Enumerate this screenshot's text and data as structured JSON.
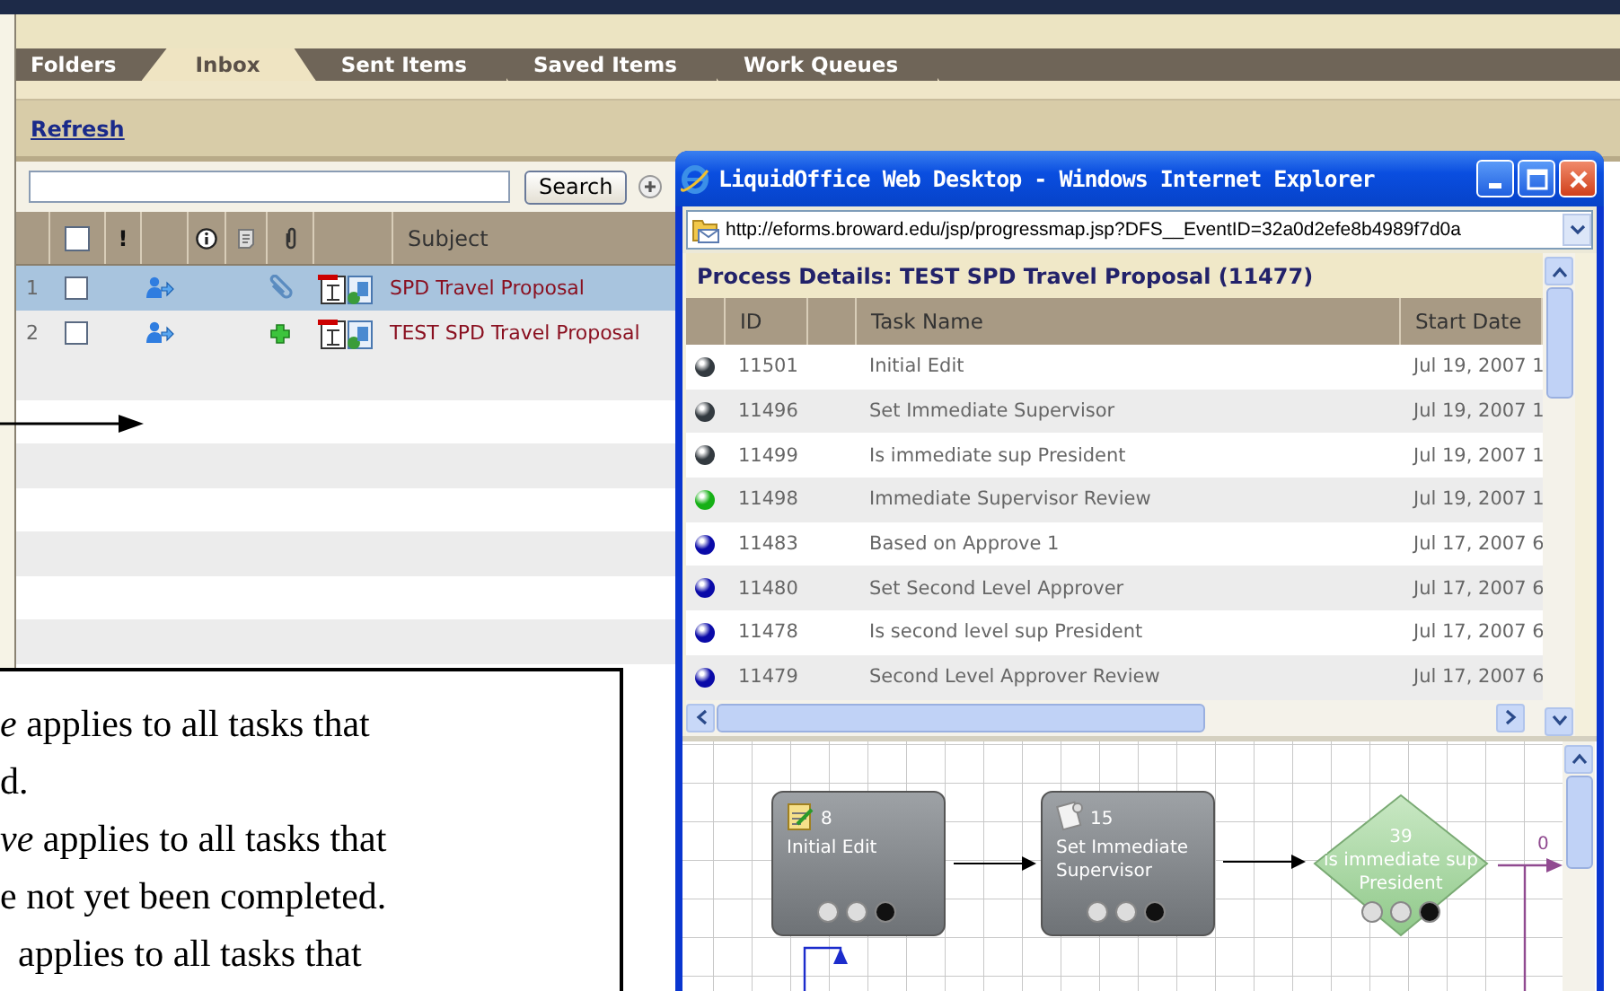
{
  "tabs": [
    {
      "label": "Folders",
      "selected": false,
      "kind": "plain"
    },
    {
      "label": "Inbox",
      "selected": true,
      "kind": "tab"
    },
    {
      "label": "Sent Items",
      "selected": false,
      "kind": "tab"
    },
    {
      "label": "Saved Items",
      "selected": false,
      "kind": "tab"
    },
    {
      "label": "Work Queues",
      "selected": false,
      "kind": "tab"
    }
  ],
  "refresh_link": "Refresh",
  "search": {
    "button": "Search"
  },
  "inbox_table": {
    "select_all_checked": false,
    "columns": [
      "!",
      "Subject"
    ],
    "rows": [
      {
        "number": "1",
        "checked": false,
        "selected": true,
        "kind": "attachment",
        "subject": "SPD Travel Proposal"
      },
      {
        "number": "2",
        "checked": false,
        "selected": false,
        "kind": "added",
        "subject": "TEST SPD Travel Proposal"
      }
    ]
  },
  "popup": {
    "title": "LiquidOffice Web Desktop - Windows Internet Explorer",
    "address": "http://eforms.broward.edu/jsp/progressmap.jsp?DFS__EventID=32a0d2efe8b4989f7d0a",
    "heading": "Process Details: TEST SPD Travel Proposal (11477)",
    "columns": [
      "ID",
      "Task Name",
      "Start Date"
    ],
    "rows": [
      {
        "color": "#333a40",
        "id": "11501",
        "task": "Initial Edit",
        "start": "Jul 19, 2007 1"
      },
      {
        "color": "#333a40",
        "id": "11496",
        "task": "Set Immediate Supervisor",
        "start": "Jul 19, 2007 1"
      },
      {
        "color": "#333a40",
        "id": "11499",
        "task": "Is immediate sup President",
        "start": "Jul 19, 2007 1"
      },
      {
        "color": "#16b016",
        "id": "11498",
        "task": "Immediate Supervisor Review",
        "start": "Jul 19, 2007 1"
      },
      {
        "color": "#0a0aa8",
        "id": "11483",
        "task": "Based on Approve 1",
        "start": "Jul 17, 2007 6"
      },
      {
        "color": "#0a0aa8",
        "id": "11480",
        "task": "Set Second Level Approver",
        "start": "Jul 17, 2007 6"
      },
      {
        "color": "#0a0aa8",
        "id": "11478",
        "task": "Is second level sup President",
        "start": "Jul 17, 2007 6"
      },
      {
        "color": "#0a0aa8",
        "id": "11479",
        "task": "Second Level Approver Review",
        "start": "Jul 17, 2007 6"
      }
    ],
    "diagram": {
      "nodes": [
        {
          "kind": "task",
          "number": "8",
          "lines": [
            "Initial Edit"
          ]
        },
        {
          "kind": "task",
          "number": "15",
          "lines": [
            "Set Immediate",
            "Supervisor"
          ]
        },
        {
          "kind": "decision",
          "number": "39",
          "lines": [
            "is immediate sup",
            "President"
          ]
        }
      ],
      "branch_label": "0"
    }
  },
  "annotation": {
    "lines": [
      "*e* applies to all tasks that",
      "d.",
      "*ve* applies to all tasks that",
      "e not yet been completed.",
      "applies to all tasks that"
    ]
  }
}
